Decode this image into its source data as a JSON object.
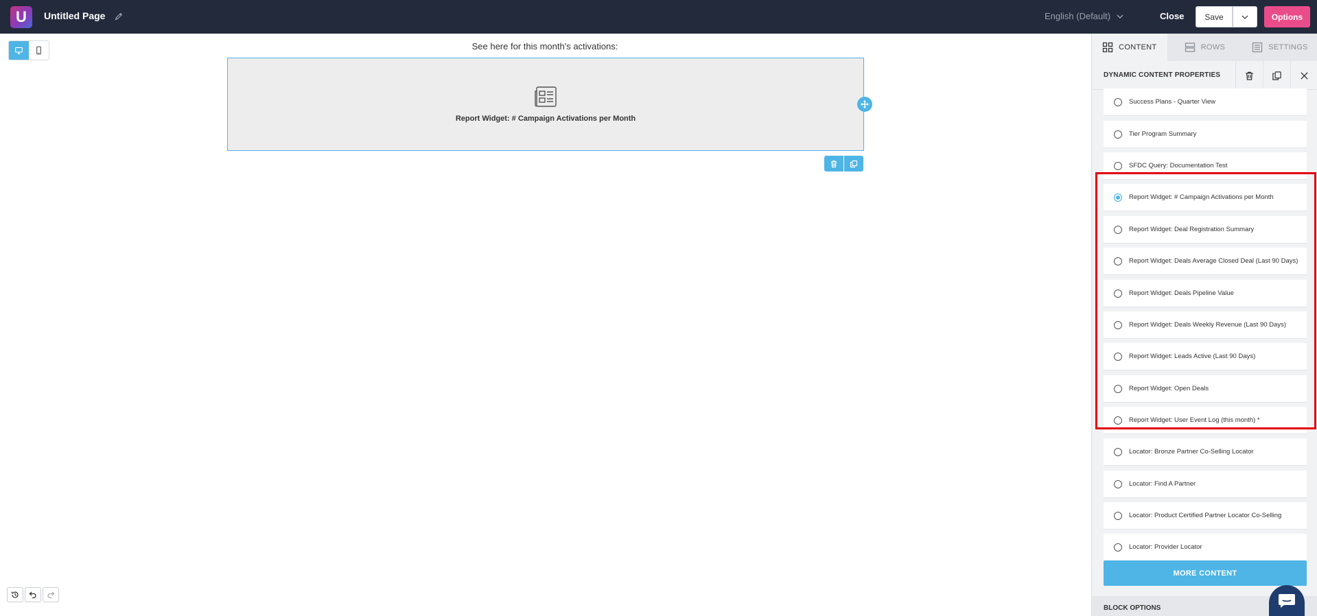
{
  "topbar": {
    "logo_letter": "U",
    "page_title": "Untitled Page",
    "language": "English (Default)",
    "close_label": "Close",
    "save_label": "Save",
    "options_label": "Options"
  },
  "canvas": {
    "heading": "See here for this month's activations:",
    "widget_label": "Report Widget: # Campaign Activations per Month"
  },
  "panel": {
    "tabs": [
      {
        "label": "CONTENT",
        "active": true
      },
      {
        "label": "ROWS",
        "active": false
      },
      {
        "label": "SETTINGS",
        "active": false
      }
    ],
    "properties_title": "DYNAMIC CONTENT PROPERTIES",
    "items": [
      {
        "label": "Success Plans - Quarter View",
        "checked": false
      },
      {
        "label": "Tier Program Summary",
        "checked": false
      },
      {
        "label": "SFDC Query: Documentation Test",
        "checked": false
      },
      {
        "label": "Report Widget: # Campaign Activations per Month",
        "checked": true
      },
      {
        "label": "Report Widget: Deal Registration Summary",
        "checked": false
      },
      {
        "label": "Report Widget: Deals Average Closed Deal (Last 90 Days)",
        "checked": false
      },
      {
        "label": "Report Widget: Deals Pipeline Value",
        "checked": false
      },
      {
        "label": "Report Widget: Deals Weekly Revenue (Last 90 Days)",
        "checked": false
      },
      {
        "label": "Report Widget: Leads Active (Last 90 Days)",
        "checked": false
      },
      {
        "label": "Report Widget: Open Deals",
        "checked": false
      },
      {
        "label": "Report Widget: User Event Log (this month) *",
        "checked": false
      },
      {
        "label": "Locator: Bronze Partner Co-Selling Locator",
        "checked": false
      },
      {
        "label": "Locator: Find A Partner",
        "checked": false
      },
      {
        "label": "Locator: Product Certified Partner Locator Co-Selling",
        "checked": false
      },
      {
        "label": "Locator: Provider Locator",
        "checked": false
      }
    ],
    "more_content_label": "MORE CONTENT",
    "block_options_label": "BLOCK OPTIONS"
  },
  "colors": {
    "topbar_bg": "#232a3b",
    "accent_blue": "#4eb5e6",
    "options_pink": "#ea4c89",
    "highlight_red": "#e3000f",
    "chat_navy": "#1f3c6e"
  }
}
